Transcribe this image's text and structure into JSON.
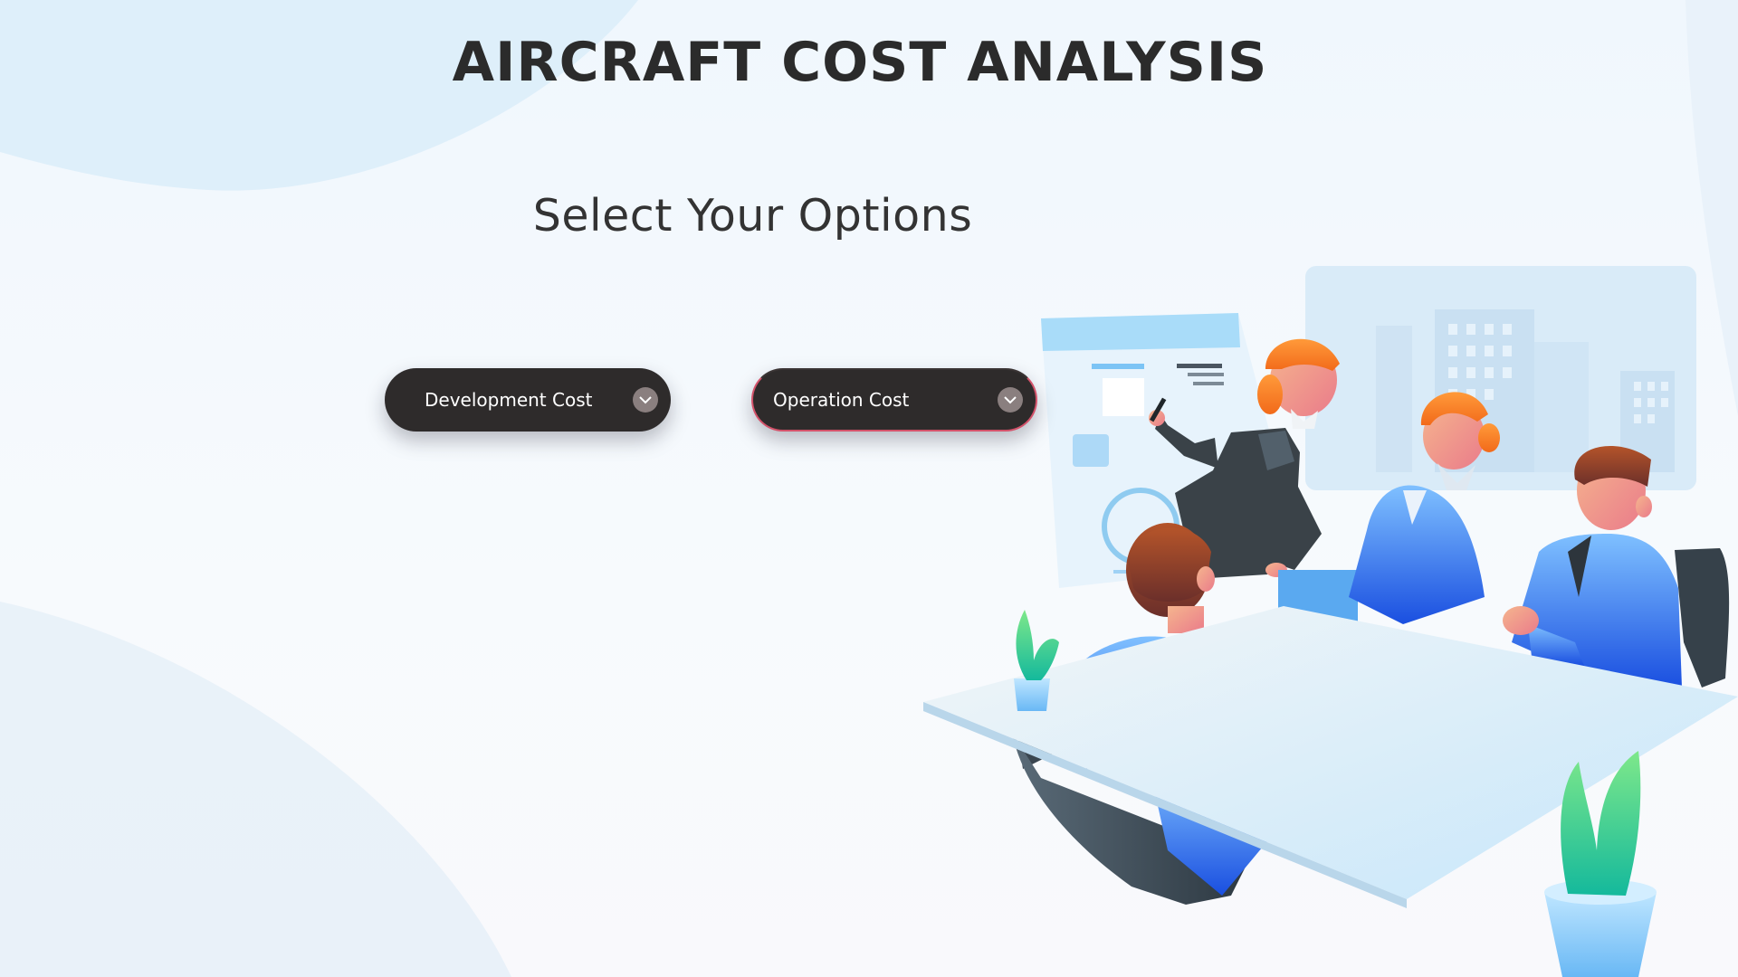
{
  "header": {
    "title": "AIRCRAFT COST ANALYSIS",
    "subtitle": "Select Your Options"
  },
  "dropdowns": [
    {
      "label": "Development Cost",
      "icon": "chevron-down-icon"
    },
    {
      "label": "Operation Cost",
      "icon": "chevron-down-icon"
    }
  ],
  "illustration": {
    "icon": "team-meeting-illustration"
  },
  "colors": {
    "background": "#f2f8fd",
    "title": "#2b2b2b",
    "dropdown_bg": "#2e2b2b",
    "dropdown_text": "#ffffff",
    "chevron_bg": "#8a7f7f",
    "focus_border": "#d3526a"
  }
}
